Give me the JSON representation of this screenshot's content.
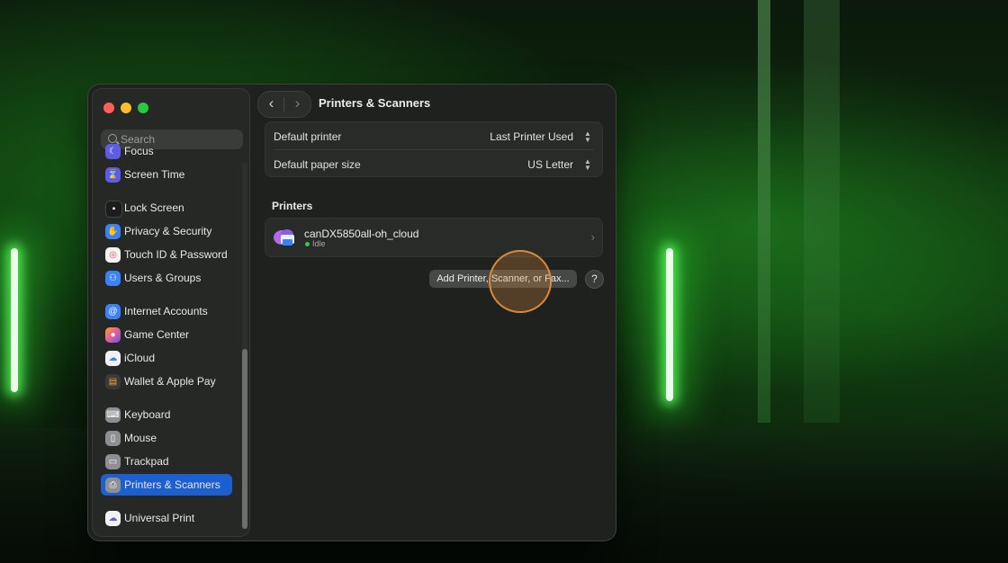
{
  "window": {
    "title": "Printers & Scanners"
  },
  "search": {
    "placeholder": "Search"
  },
  "sidebar": {
    "items": [
      {
        "label": "Focus",
        "icon": "moon-icon",
        "color": "#5e5ce6"
      },
      {
        "label": "Screen Time",
        "icon": "hourglass-icon",
        "color": "#5e5ce6"
      },
      {
        "label": "Lock Screen",
        "icon": "lock-icon",
        "color": "#1c1c1e"
      },
      {
        "label": "Privacy & Security",
        "icon": "hand-icon",
        "color": "#3a82f7"
      },
      {
        "label": "Touch ID & Password",
        "icon": "fingerprint-icon",
        "color": "#f2f2f2"
      },
      {
        "label": "Users & Groups",
        "icon": "users-icon",
        "color": "#3a82f7"
      },
      {
        "label": "Internet Accounts",
        "icon": "at-icon",
        "color": "#3a82f7"
      },
      {
        "label": "Game Center",
        "icon": "game-center-icon",
        "color": "#e85aa0"
      },
      {
        "label": "iCloud",
        "icon": "cloud-icon",
        "color": "#f2f2f2"
      },
      {
        "label": "Wallet & Apple Pay",
        "icon": "wallet-icon",
        "color": "#3a3a3c"
      },
      {
        "label": "Keyboard",
        "icon": "keyboard-icon",
        "color": "#8e8e93"
      },
      {
        "label": "Mouse",
        "icon": "mouse-icon",
        "color": "#8e8e93"
      },
      {
        "label": "Trackpad",
        "icon": "trackpad-icon",
        "color": "#8e8e93"
      },
      {
        "label": "Printers & Scanners",
        "icon": "printer-icon",
        "color": "#8e8e93",
        "selected": true
      },
      {
        "label": "Universal Print",
        "icon": "universal-print-icon",
        "color": "#f2f2f2"
      }
    ]
  },
  "settings": {
    "default_printer": {
      "label": "Default printer",
      "value": "Last Printer Used"
    },
    "default_paper": {
      "label": "Default paper size",
      "value": "US Letter"
    }
  },
  "printers": {
    "section_title": "Printers",
    "items": [
      {
        "name": "canDX5850all-oh_cloud",
        "status": "Idle"
      }
    ]
  },
  "actions": {
    "add_label": "Add Printer, Scanner, or Fax...",
    "help_label": "?"
  },
  "colors": {
    "accent": "#1b5fd0",
    "status_idle": "#36c84a"
  }
}
